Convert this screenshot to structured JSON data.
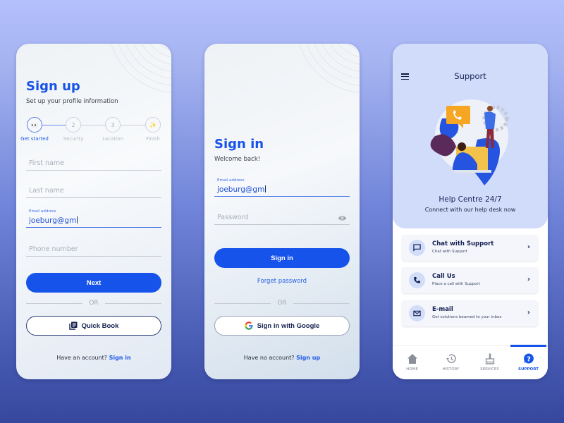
{
  "signup": {
    "title": "Sign up",
    "subtitle": "Set up your profile information",
    "steps": [
      {
        "label": "Get started",
        "icon": "👀",
        "active": true
      },
      {
        "label": "Security",
        "icon": "2",
        "active": false
      },
      {
        "label": "Location",
        "icon": "3",
        "active": false
      },
      {
        "label": "Finish",
        "icon": "✨",
        "active": false
      }
    ],
    "fields": {
      "first_name_placeholder": "First name",
      "last_name_placeholder": "Last name",
      "email_label": "Email address",
      "email_value": "joeburg@gm",
      "phone_placeholder": "Phone number"
    },
    "next_label": "Next",
    "or_label": "OR",
    "quick_book_label": "Quick Book",
    "footer_text": "Have an account?",
    "footer_link": "Sign in"
  },
  "signin": {
    "title": "Sign in",
    "subtitle": "Welcome back!",
    "fields": {
      "email_label": "Email address",
      "email_value": "joeburg@gm",
      "password_placeholder": "Password"
    },
    "sign_in_label": "Sign in",
    "forget_label": "Forget password",
    "or_label": "OR",
    "google_label": "Sign in with Google",
    "footer_text": "Have no account?",
    "footer_link": "Sign up"
  },
  "support": {
    "title": "Support",
    "help_title": "Help Centre 24/7",
    "help_subtitle": "Connect with our help desk now",
    "cards": [
      {
        "title": "Chat with Support",
        "subtitle": "Chat with Support",
        "icon": "chat-icon"
      },
      {
        "title": "Call Us",
        "subtitle": "Place a call with Support",
        "icon": "phone-icon"
      },
      {
        "title": "E-mail",
        "subtitle": "Get solutions beamed to your inbox",
        "icon": "mail-icon"
      }
    ],
    "tabs": [
      {
        "label": "HOME",
        "icon": "home-icon",
        "active": false
      },
      {
        "label": "HISTORY",
        "icon": "history-icon",
        "active": false
      },
      {
        "label": "SERVICES",
        "icon": "broom-icon",
        "active": false
      },
      {
        "label": "SUPPORT",
        "icon": "help-icon",
        "active": true
      }
    ]
  },
  "colors": {
    "primary": "#1653ea",
    "navy": "#142052",
    "support_header": "#d1dcfb"
  }
}
